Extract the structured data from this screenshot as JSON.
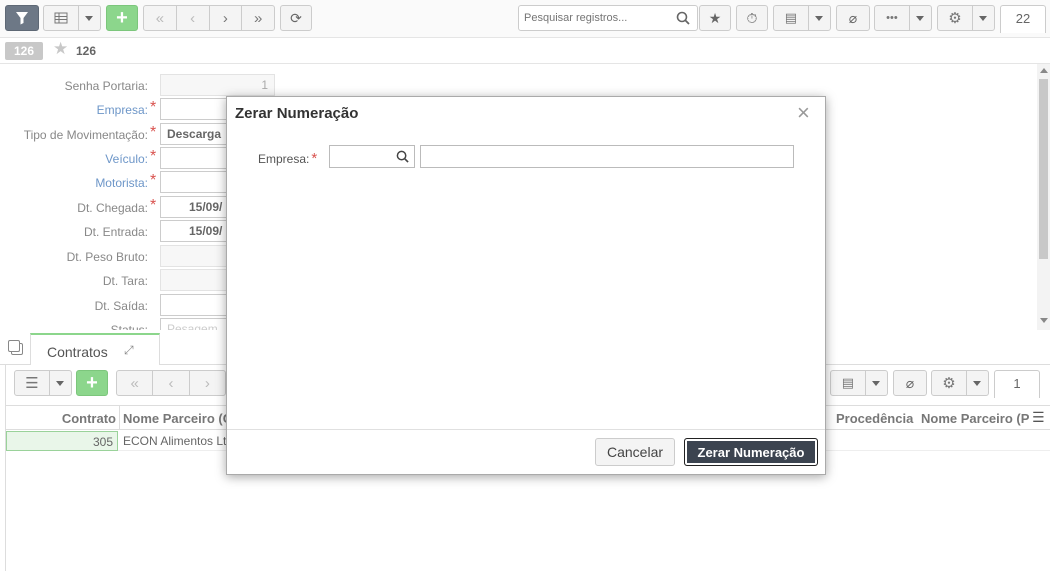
{
  "toolbar": {
    "search_placeholder": "Pesquisar registros...",
    "page_count": "22",
    "icons": [
      "filter-icon",
      "grid-icon",
      "plus-icon",
      "first-icon",
      "prev-icon",
      "next-icon",
      "last-icon",
      "refresh-icon",
      "search-icon",
      "star-icon",
      "timer-icon",
      "export-icon",
      "attach-icon",
      "more-icon",
      "gear-icon"
    ]
  },
  "record": {
    "badge": "126",
    "number": "126"
  },
  "form": {
    "fields": [
      {
        "label": "Senha Portaria:",
        "value": "1",
        "required": false,
        "link": false
      },
      {
        "label": "Empresa:",
        "value": "",
        "required": true,
        "link": true
      },
      {
        "label": "Tipo de Movimentação:",
        "value": "Descarga",
        "required": true,
        "link": false
      },
      {
        "label": "Veículo:",
        "value": "",
        "required": true,
        "link": true
      },
      {
        "label": "Motorista:",
        "value": "",
        "required": true,
        "link": true
      },
      {
        "label": "Dt. Chegada:",
        "value": "15/09/",
        "required": true,
        "link": false
      },
      {
        "label": "Dt. Entrada:",
        "value": "15/09/",
        "required": false,
        "link": false
      },
      {
        "label": "Dt. Peso Bruto:",
        "value": "",
        "required": false,
        "link": false
      },
      {
        "label": "Dt. Tara:",
        "value": "",
        "required": false,
        "link": false
      },
      {
        "label": "Dt. Saída:",
        "value": "",
        "required": false,
        "link": false
      },
      {
        "label": "Status:",
        "value": "Pesagem",
        "required": false,
        "link": false
      }
    ]
  },
  "subtab": {
    "label": "Contratos"
  },
  "subtoolbar": {
    "page_count": "1"
  },
  "grid": {
    "headers": [
      "Contrato",
      "Nome Parceiro (C",
      "Procedência",
      "Nome Parceiro (P"
    ],
    "rows": [
      {
        "contrato": "305",
        "parceiro": "ECON Alimentos Lt"
      }
    ]
  },
  "dialog": {
    "title": "Zerar Numeração",
    "empresa_label": "Empresa:",
    "empresa_value": "",
    "empresa_desc": "",
    "cancel_label": "Cancelar",
    "confirm_label": "Zerar Numeração"
  },
  "colors": {
    "accent_green": "#8cd68c",
    "link_blue": "#6d96c8",
    "required_red": "#d9534f",
    "dark_button": "#3c4450"
  }
}
